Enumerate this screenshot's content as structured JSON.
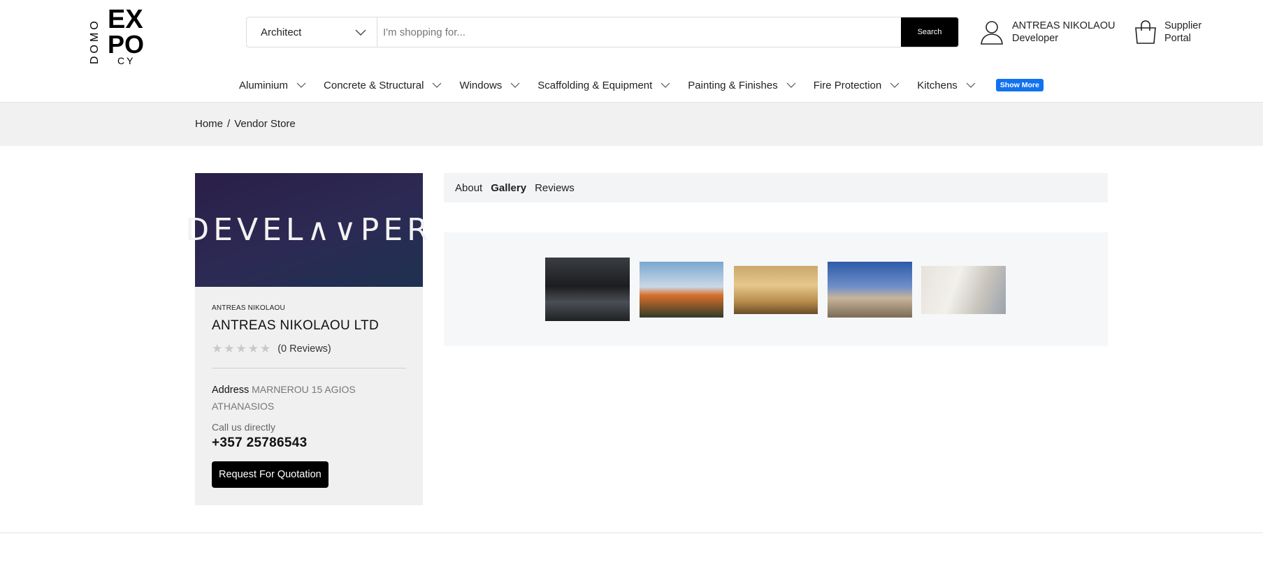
{
  "logo": {
    "alt": "DOMO EXPO CY",
    "letters": [
      "EX",
      "PO",
      "CY",
      "DOMO"
    ]
  },
  "search": {
    "category": "Architect",
    "placeholder": "I'm shopping for...",
    "button_label": "Search"
  },
  "account": {
    "name": "ANTREAS NIKOLAOU",
    "role": "Developer"
  },
  "supplier": {
    "line1": "Supplier",
    "line2": "Portal"
  },
  "nav": {
    "items": [
      {
        "label": "Aluminium"
      },
      {
        "label": "Concrete & Structural"
      },
      {
        "label": "Windows"
      },
      {
        "label": "Scaffolding & Equipment"
      },
      {
        "label": "Painting & Finishes"
      },
      {
        "label": "Fire Protection"
      },
      {
        "label": "Kitchens"
      }
    ],
    "show_more": "Show More",
    "show_more_color": "#1072f0"
  },
  "breadcrumb": {
    "home": "Home",
    "separator": "/",
    "current": "Vendor Store"
  },
  "vendor": {
    "banner_text": "DEVEL∧∨PER",
    "small_name": "ANTREAS NIKOLAOU",
    "company": "ANTREAS NIKOLAOU LTD",
    "stars": "★★★★★",
    "rating_value": 0,
    "reviews": "(0 Reviews)",
    "address_label": "Address",
    "address_value": "MARNEROU 15 AGIOS ATHANASIOS",
    "call_label": "Call us directly",
    "phone": "+357 25786543",
    "rfq_label": "Request For Quotation"
  },
  "tabs": [
    {
      "label": "About",
      "active": false
    },
    {
      "label": "Gallery",
      "active": true
    },
    {
      "label": "Reviews",
      "active": false
    }
  ],
  "gallery": [
    {
      "name": "gallery-image-interior"
    },
    {
      "name": "gallery-image-surveyor"
    },
    {
      "name": "gallery-image-framing"
    },
    {
      "name": "gallery-image-roof-workers"
    },
    {
      "name": "gallery-image-architect-model"
    }
  ]
}
